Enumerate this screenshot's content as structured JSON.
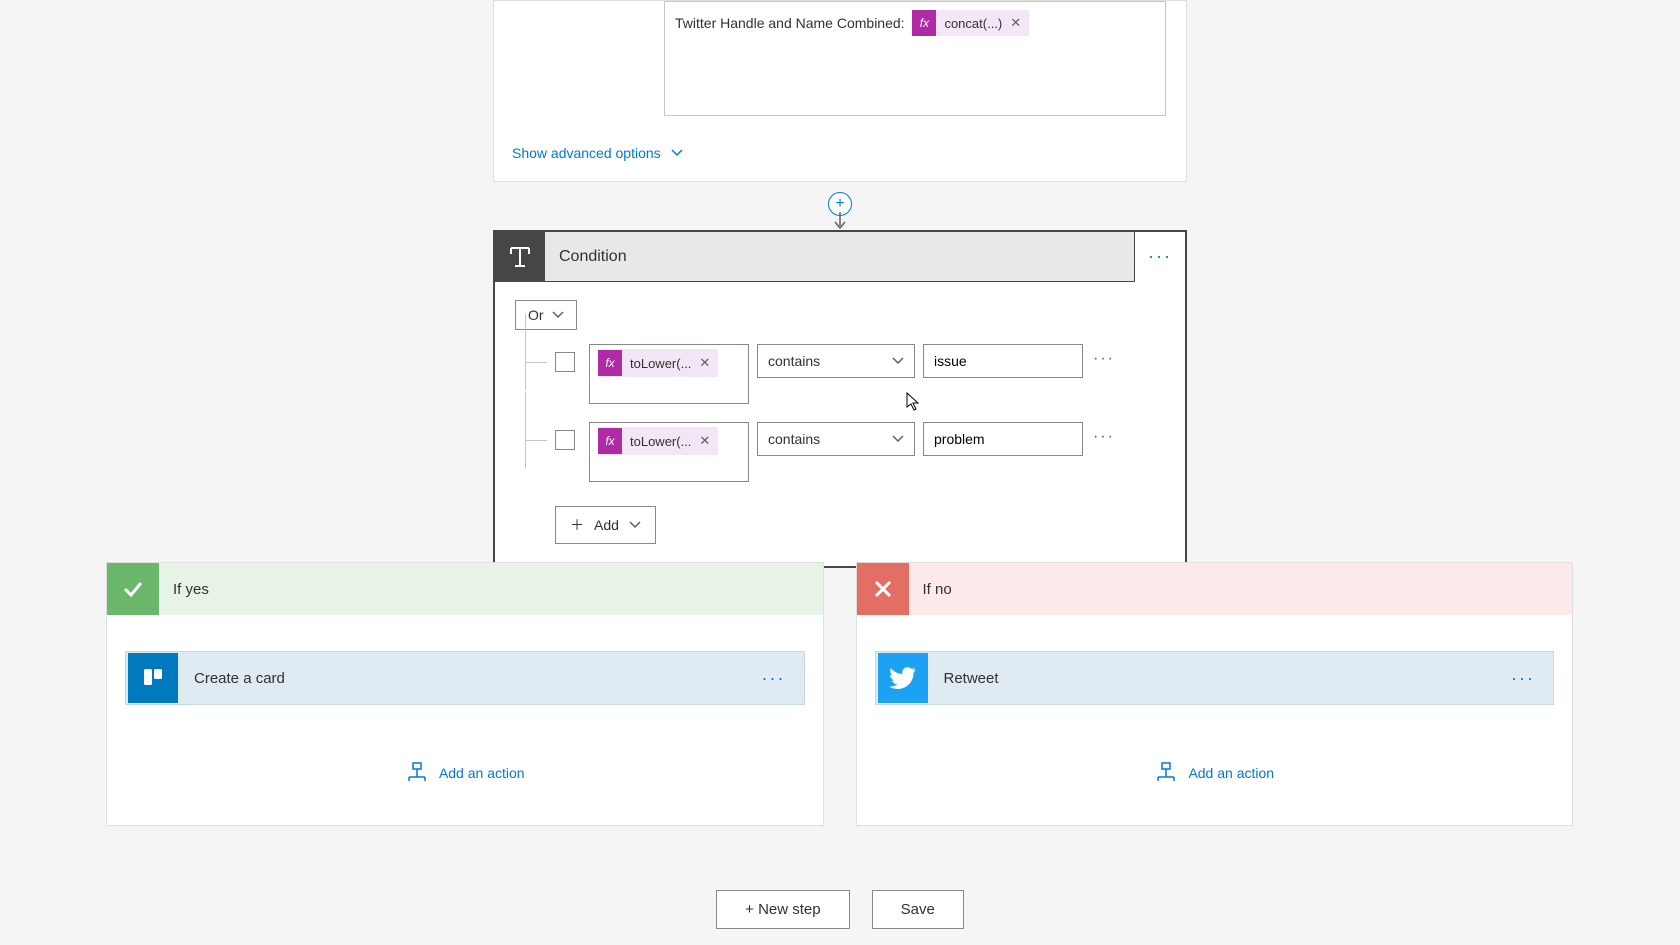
{
  "top_card": {
    "field_label": "Twitter Handle and Name Combined:",
    "token": {
      "fx": "fx",
      "expr": "concat(...)"
    },
    "show_advanced": "Show advanced options"
  },
  "condition": {
    "title": "Condition",
    "group_operator": "Or",
    "rows": [
      {
        "fx": "fx",
        "expr": "toLower(...",
        "operator": "contains",
        "value": "issue"
      },
      {
        "fx": "fx",
        "expr": "toLower(...",
        "operator": "contains",
        "value": "problem"
      }
    ],
    "add_label": "Add"
  },
  "branches": {
    "yes": {
      "title": "If yes",
      "action": {
        "title": "Create a card",
        "icon": "trello"
      },
      "add_action": "Add an action"
    },
    "no": {
      "title": "If no",
      "action": {
        "title": "Retweet",
        "icon": "twitter"
      },
      "add_action": "Add an action"
    }
  },
  "buttons": {
    "new_step": "+ New step",
    "save": "Save"
  }
}
